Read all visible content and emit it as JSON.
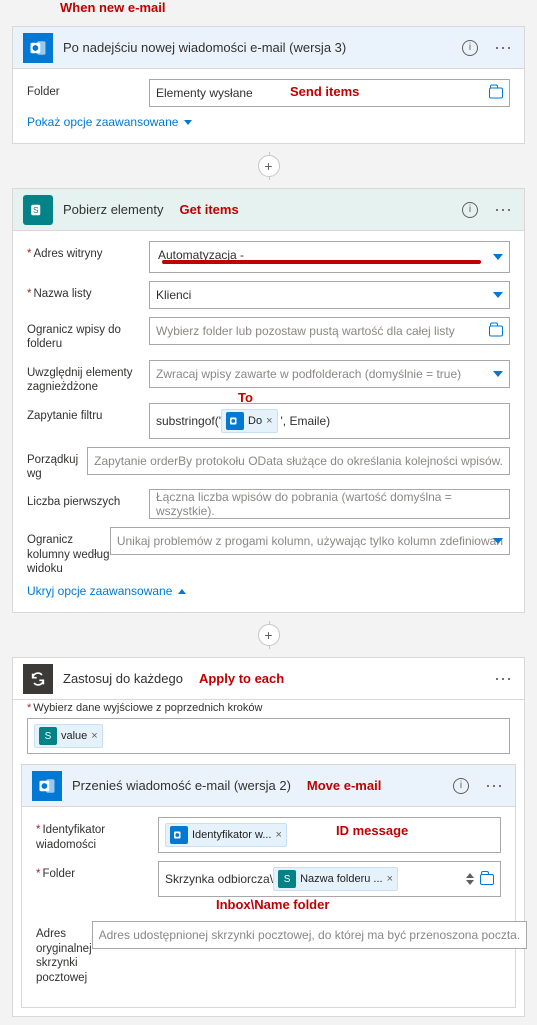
{
  "annotations": {
    "when_new_email": "When new e-mail",
    "send_items": "Send items",
    "get_items": "Get items",
    "to": "To",
    "apply_to_each": "Apply to each",
    "move_email": "Move e-mail",
    "id_message": "ID message",
    "inbox_name_folder": "Inbox\\Name folder"
  },
  "trigger": {
    "title": "Po nadejściu nowej wiadomości e-mail (wersja 3)",
    "folder_label": "Folder",
    "folder_value": "Elementy wysłane",
    "show_advanced": "Pokaż opcje zaawansowane"
  },
  "getitems": {
    "title": "Pobierz elementy",
    "site_label": "Adres witryny",
    "site_value": "Automatyzacja -",
    "list_label": "Nazwa listy",
    "list_value": "Klienci",
    "limit_folder_label": "Ogranicz wpisy do folderu",
    "limit_folder_ph": "Wybierz folder lub pozostaw pustą wartość dla całej listy",
    "nested_label": "Uwzględnij elementy zagnieżdżone",
    "nested_ph": "Zwracaj wpisy zawarte w podfolderach (domyślnie = true)",
    "filter_label": "Zapytanie filtru",
    "filter_prefix": "substringof('",
    "filter_token": "Do",
    "filter_suffix": "', Emaile)",
    "orderby_label": "Porządkuj wg",
    "orderby_ph": "Zapytanie orderBy protokołu OData służące do określania kolejności wpisów.",
    "top_label": "Liczba pierwszych",
    "top_ph": "Łączna liczba wpisów do pobrania (wartość domyślna = wszystkie).",
    "view_label": "Ogranicz kolumny według widoku",
    "view_ph": "Unikaj problemów z progami kolumn, używając tylko kolumn zdefiniowan",
    "hide_advanced": "Ukryj opcje zaawansowane"
  },
  "apply": {
    "title": "Zastosuj do każdego",
    "select_label": "Wybierz dane wyjściowe z poprzednich kroków",
    "value_token": "value"
  },
  "move": {
    "title": "Przenieś wiadomość e-mail (wersja 2)",
    "id_label": "Identyfikator wiadomości",
    "id_token": "Identyfikator w...",
    "folder_label": "Folder",
    "folder_text": "Skrzynka odbiorcza",
    "folder_token": "Nazwa folderu ...",
    "orig_label": "Adres oryginalnej skrzynki pocztowej",
    "orig_ph": "Adres udostępnionej skrzynki pocztowej, do której ma być przenoszona poczta."
  }
}
